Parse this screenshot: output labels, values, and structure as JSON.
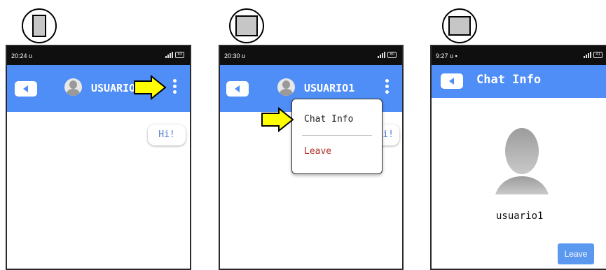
{
  "screens": [
    {
      "status_time": "20:24",
      "status_icon": "ʊ",
      "battery": "83",
      "header_title": "USUARIO1",
      "bubble_text": "Hi!"
    },
    {
      "status_time": "20:30",
      "status_icon": "ʊ",
      "battery": "80",
      "header_title": "USUARIO1",
      "bubble_text": "i!",
      "menu": {
        "items": [
          "Chat Info",
          "Leave"
        ]
      }
    },
    {
      "status_time": "9:27",
      "status_icon": "ʊ",
      "battery": "41",
      "header_title": "Chat Info",
      "username": "usuario1",
      "leave_label": "Leave"
    }
  ],
  "icons": {
    "back": "back-arrow-icon",
    "overflow": "more-vertical-icon",
    "avatar": "user-avatar-icon",
    "pointer": "yellow-arrow-icon"
  },
  "colors": {
    "appbar": "#4f8ef7",
    "status_bar": "#0f0f0f",
    "arrow_fill": "#ffff00",
    "leave_text": "#b0302a"
  }
}
